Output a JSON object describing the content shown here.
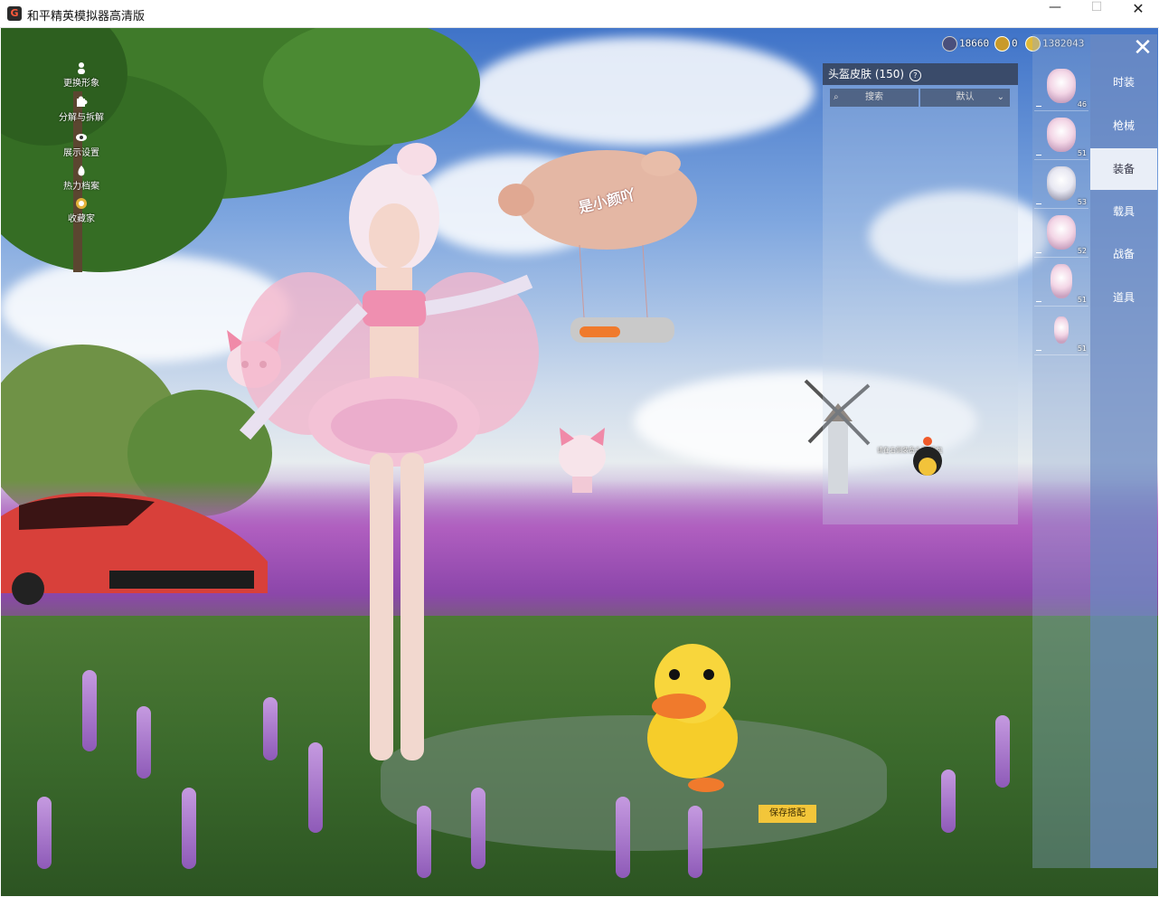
{
  "window": {
    "title": "和平精英模拟器高清版",
    "min_glyph": "—",
    "max_glyph": "☐",
    "close_glyph": "✕"
  },
  "left_menu": {
    "items": [
      {
        "label": "更换形象",
        "icon": "person-icon"
      },
      {
        "label": "分解与拆解",
        "icon": "puzzle-icon"
      },
      {
        "label": "展示设置",
        "icon": "eye-icon"
      },
      {
        "label": "热力档案",
        "icon": "flame-icon"
      },
      {
        "label": "收藏家",
        "icon": "collector-badge-icon"
      }
    ]
  },
  "currency": {
    "first": "18660",
    "second": "0",
    "third": "1382043"
  },
  "panel": {
    "title": "头盔皮肤 (150)",
    "search_label": "搜索",
    "sort_label": "默认",
    "hint": "请在右侧装备头盔/背包"
  },
  "items": [
    {
      "count": "46"
    },
    {
      "count": "51"
    },
    {
      "count": "53"
    },
    {
      "count": "52"
    },
    {
      "count": "51"
    },
    {
      "count": "51"
    }
  ],
  "tabs": [
    {
      "label": "时装",
      "active": false
    },
    {
      "label": "枪械",
      "active": false
    },
    {
      "label": "装备",
      "active": true
    },
    {
      "label": "载具",
      "active": false
    },
    {
      "label": "战备",
      "active": false
    },
    {
      "label": "道具",
      "active": false
    }
  ],
  "blimp_text": "是小颜吖",
  "save_label": "保存搭配",
  "colors": {
    "accent": "#f3c63a",
    "tab_bg": "#6e8cc3",
    "panel_head": "#283246"
  }
}
